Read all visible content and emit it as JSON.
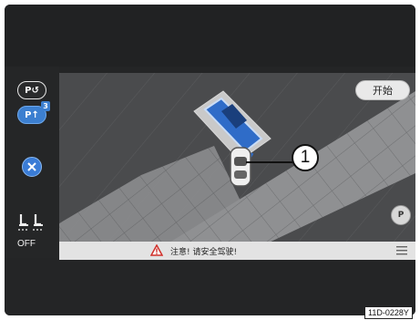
{
  "sidebar": {
    "park_out_label": "P↺",
    "park_mode_label": "P↑",
    "park_mode_badge": "3",
    "cancel_icon": "close-icon",
    "seat_heating_label": "OFF"
  },
  "camera": {
    "start_button_label": "开始",
    "callout_number": "1",
    "park_button_label": "P"
  },
  "warning": {
    "text": "注意! 请安全驾驶!",
    "icon": "warning-triangle-icon"
  },
  "figure_label": "11D-0228Y",
  "colors": {
    "accent_blue": "#3c7fd0",
    "warning_red": "#d0302a"
  }
}
